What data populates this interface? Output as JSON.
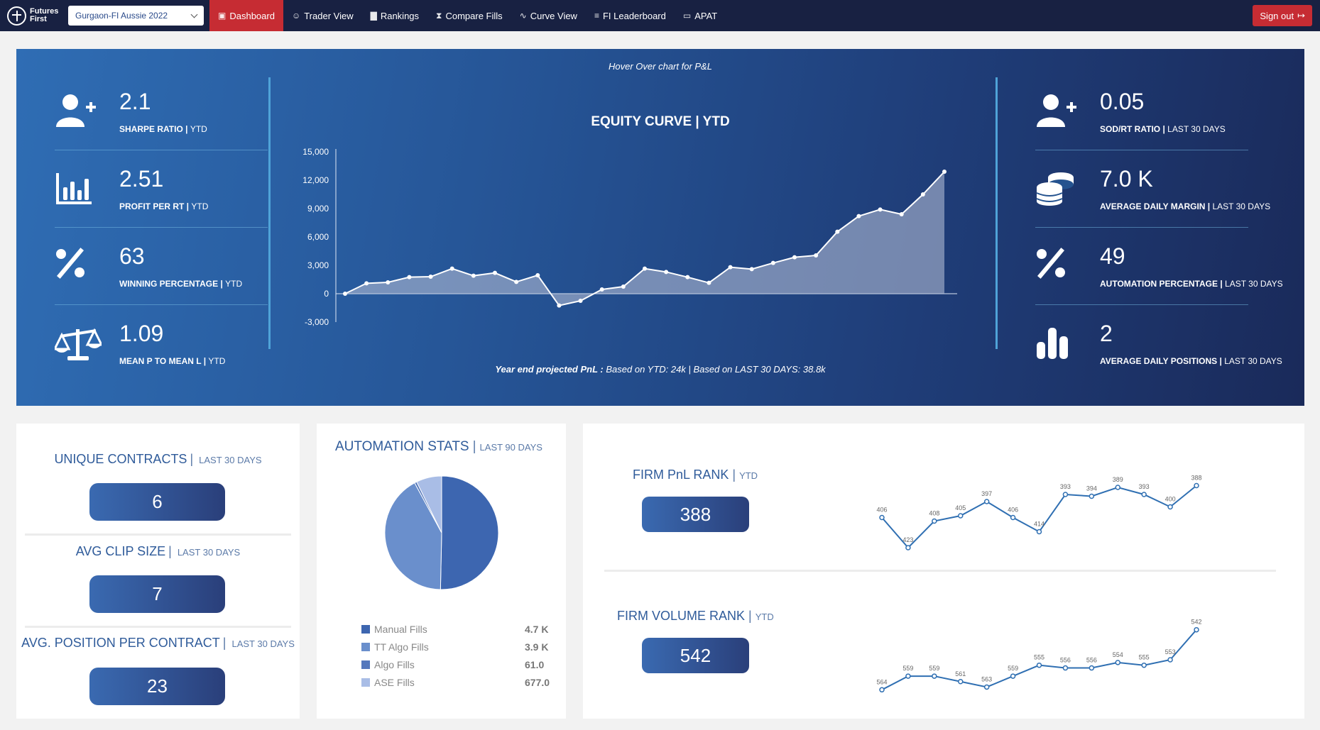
{
  "nav": {
    "logo_line1": "Futures",
    "logo_line2": "First",
    "selected_account": "Gurgaon-FI Aussie 2022",
    "items": [
      {
        "label": "Dashboard",
        "icon": "dashboard-icon"
      },
      {
        "label": "Trader View",
        "icon": "users-icon"
      },
      {
        "label": "Rankings",
        "icon": "bar-chart-icon"
      },
      {
        "label": "Compare Fills",
        "icon": "hourglass-icon"
      },
      {
        "label": "Curve View",
        "icon": "pulse-icon"
      },
      {
        "label": "FI Leaderboard",
        "icon": "leaderboard-icon"
      },
      {
        "label": "APAT",
        "icon": "monitor-icon"
      }
    ],
    "signout_label": "Sign out"
  },
  "hero": {
    "hover_note": "Hover Over chart for P&L",
    "left_stats": [
      {
        "value": "2.1",
        "label": "SHARPE RATIO",
        "period": "YTD",
        "icon": "add-user-icon"
      },
      {
        "value": "2.51",
        "label": "PROFIT PER RT",
        "period": "YTD",
        "icon": "bar-chart-icon"
      },
      {
        "value": "63",
        "label": "WINNING PERCENTAGE",
        "period": "YTD",
        "icon": "percent-icon"
      },
      {
        "value": "1.09",
        "label": "MEAN P TO MEAN L",
        "period": "YTD",
        "icon": "balance-scale-icon"
      }
    ],
    "right_stats": [
      {
        "value": "0.05",
        "label": "SOD/RT RATIO",
        "period": "LAST 30 DAYS",
        "icon": "add-user-icon"
      },
      {
        "value": "7.0 K",
        "label": "AVERAGE DAILY MARGIN",
        "period": "LAST 30 DAYS",
        "icon": "coins-icon"
      },
      {
        "value": "49",
        "label": "AUTOMATION PERCENTAGE",
        "period": "LAST 30 DAYS",
        "icon": "percent-icon"
      },
      {
        "value": "2",
        "label": "AVERAGE DAILY POSITIONS",
        "period": "LAST 30 DAYS",
        "icon": "bars-icon"
      }
    ],
    "equity_title": "EQUITY CURVE | YTD",
    "projection_label": "Year end projected PnL :",
    "projection_text": "Based on YTD: 24k | Based on LAST 30 DAYS: 38.8k"
  },
  "kpis": {
    "unique_contracts": {
      "title": "UNIQUE CONTRACTS",
      "period": "LAST 30 DAYS",
      "value": "6"
    },
    "avg_clip": {
      "title": "AVG CLIP SIZE",
      "period": "LAST 30 DAYS",
      "value": "7"
    },
    "avg_position": {
      "title": "AVG. POSITION PER CONTRACT",
      "period": "LAST 30 DAYS",
      "value": "23"
    }
  },
  "automation": {
    "title": "AUTOMATION STATS",
    "period": "LAST 90 DAYS",
    "legend": [
      {
        "label": "Manual Fills",
        "value": "4.7 K",
        "color": "#3d66b0"
      },
      {
        "label": "TT Algo Fills",
        "value": "3.9 K",
        "color": "#6a8fcc"
      },
      {
        "label": "Algo Fills",
        "value": "61.0",
        "color": "#5578bc"
      },
      {
        "label": "ASE Fills",
        "value": "677.0",
        "color": "#a9bde6"
      }
    ]
  },
  "ranks": {
    "pnl": {
      "title": "FIRM PnL RANK",
      "period": "YTD",
      "value": "388"
    },
    "volume": {
      "title": "FIRM VOLUME RANK",
      "period": "YTD",
      "value": "542"
    }
  },
  "chart_data": [
    {
      "type": "area",
      "title": "EQUITY CURVE | YTD",
      "y_ticks": [
        "15,000",
        "12,000",
        "9,000",
        "6,000",
        "3,000",
        "0",
        "-3,000"
      ],
      "ylim": [
        -3000,
        15000
      ],
      "values": [
        0,
        1100,
        1200,
        1750,
        1800,
        2650,
        1900,
        2200,
        1250,
        1950,
        -1250,
        -750,
        450,
        750,
        2650,
        2300,
        1750,
        1150,
        2800,
        2600,
        3250,
        3850,
        4050,
        6550,
        8200,
        8900,
        8400,
        10500,
        12900
      ]
    },
    {
      "type": "pie",
      "title": "AUTOMATION STATS",
      "slices": [
        {
          "name": "Manual Fills",
          "value": 4700
        },
        {
          "name": "TT Algo Fills",
          "value": 3900
        },
        {
          "name": "Algo Fills",
          "value": 61
        },
        {
          "name": "ASE Fills",
          "value": 677
        }
      ]
    },
    {
      "type": "line",
      "title": "FIRM PnL RANK",
      "values": [
        406,
        423,
        408,
        405,
        397,
        406,
        414,
        393,
        394,
        389,
        393,
        400,
        388
      ],
      "ylim": [
        385,
        425
      ]
    },
    {
      "type": "line",
      "title": "FIRM VOLUME RANK",
      "values": [
        564,
        559,
        559,
        561,
        563,
        559,
        555,
        556,
        556,
        554,
        555,
        553,
        542
      ],
      "ylim": [
        540,
        566
      ]
    }
  ],
  "colors": {
    "navbar": "#182142",
    "accent_red": "#c62c33",
    "brand_blue": "#2f5b9a"
  }
}
